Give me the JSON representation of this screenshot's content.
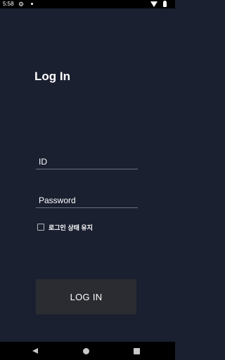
{
  "status_bar": {
    "time": "5:58",
    "icons": [
      "gear-icon",
      "notification-dot-icon",
      "wifi-icon",
      "battery-icon"
    ]
  },
  "login": {
    "title": "Log In",
    "id_placeholder": "ID",
    "password_placeholder": "Password",
    "remember_label": "로그인 상태 유지",
    "remember_checked": false,
    "button_label": "LOG IN"
  },
  "nav_bar": {
    "icons": [
      "back-icon",
      "home-icon",
      "recents-icon"
    ]
  },
  "colors": {
    "background": "#1b2030",
    "button": "#2b2c31",
    "text": "#ffffff"
  }
}
